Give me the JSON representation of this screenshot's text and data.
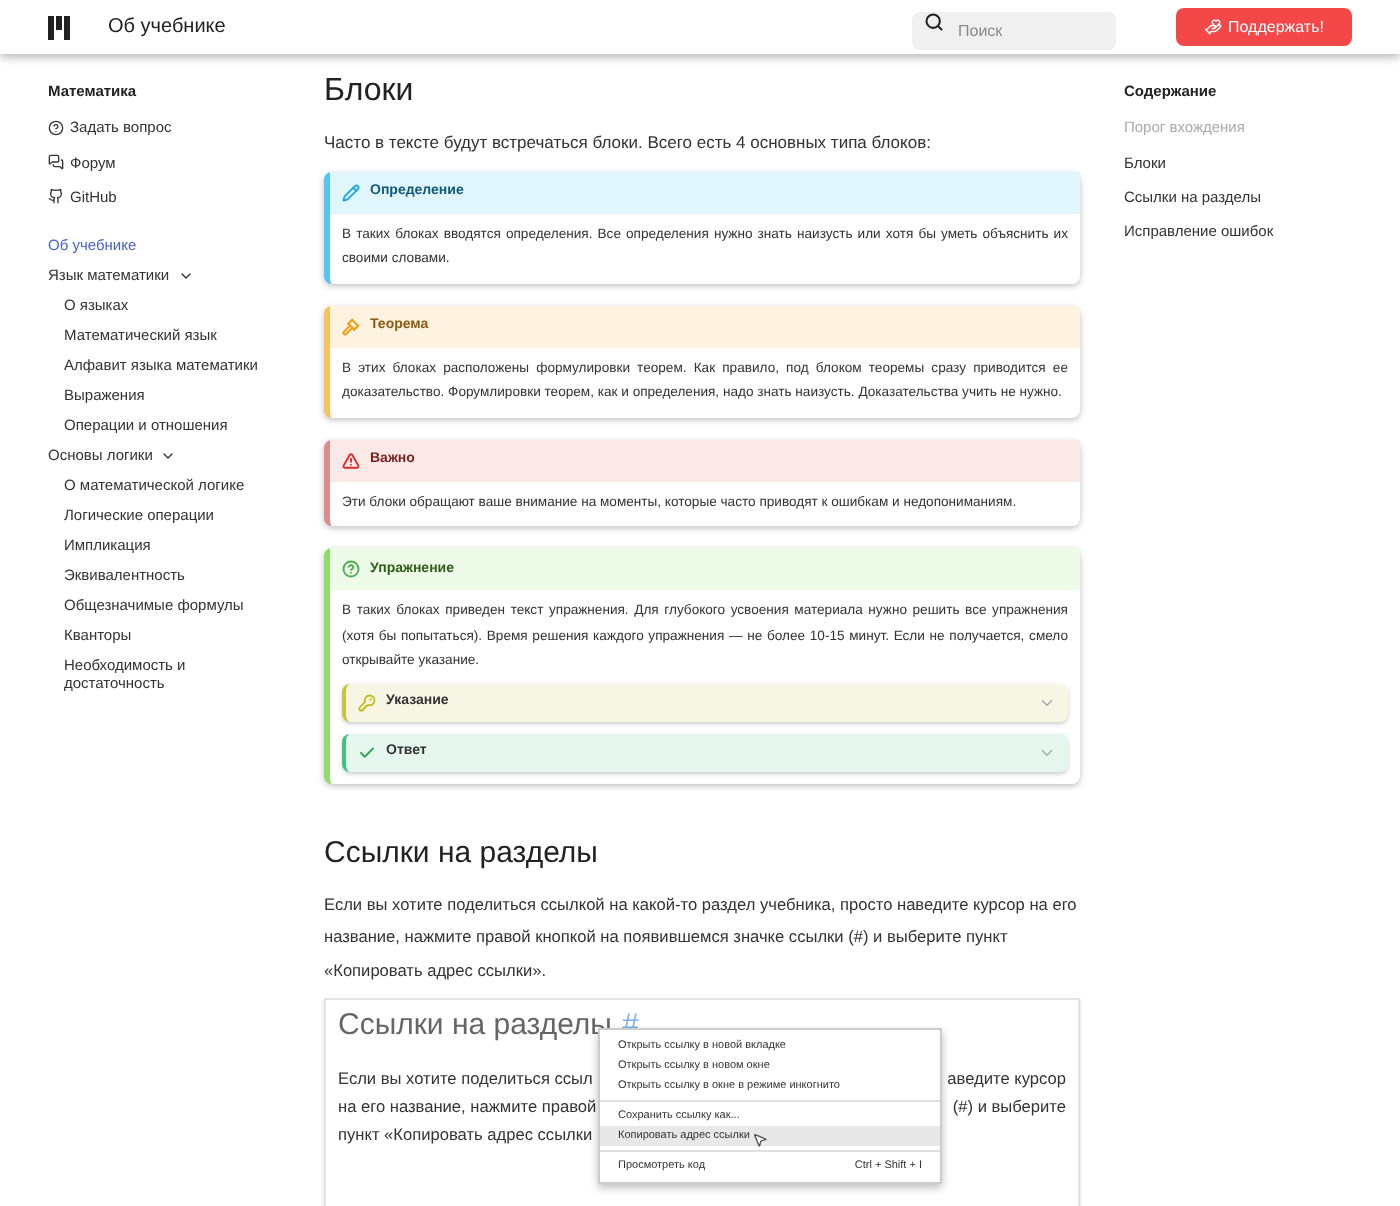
{
  "header": {
    "title": "Об учебнике",
    "search": {
      "placeholder": "Поиск"
    },
    "support_button": "Поддержать!"
  },
  "sidebar": {
    "heading": "Математика",
    "links": [
      {
        "kind": "question",
        "label": "Задать вопрос"
      },
      {
        "kind": "forum",
        "label": "Форум"
      },
      {
        "kind": "github",
        "label": "GitHub"
      }
    ],
    "items": [
      {
        "label": "Об учебнике",
        "selected": true
      },
      {
        "label": "Язык математики",
        "selected": false,
        "expanded": true,
        "children": [
          {
            "label": "О языках",
            "selected": false
          },
          {
            "label": "Математический язык",
            "selected": false
          },
          {
            "label": "Алфавит языка математики",
            "selected": false
          },
          {
            "label": "Выражения",
            "selected": false
          },
          {
            "label": "Операции и отношения",
            "selected": false
          }
        ]
      },
      {
        "label": "Основы логики",
        "selected": false,
        "expanded": true,
        "children": [
          {
            "label": "О математической логике",
            "selected": false
          },
          {
            "label": "Логические операции",
            "selected": false
          },
          {
            "label": "Импликация",
            "selected": false
          },
          {
            "label": "Эквивалентность",
            "selected": false
          },
          {
            "label": "Общезначимые формулы",
            "selected": false
          },
          {
            "label": "Кванторы",
            "selected": false
          },
          {
            "label": "Необходимость и достаточность",
            "selected": false
          }
        ]
      }
    ]
  },
  "main": {
    "title": "Блоки",
    "intro": "Часто в тексте будут встречаться блоки. Всего есть 4 основных типа блоков:",
    "blocks": [
      {
        "kind": "definition",
        "title": "Определение",
        "text": "В таких блоках вводятся определения. Все определения нужно знать наизусть или хотя бы уметь объяснить их своими словами."
      },
      {
        "kind": "theorem",
        "title": "Теорема",
        "text": "В этих блоках расположены формулировки теорем. Как правило, под блоком теоремы сразу приводится ее доказательство. Форумлировки теорем, как и определения, надо знать наизусть. Доказательства учить не нужно."
      },
      {
        "kind": "important",
        "title": "Важно",
        "text": "Эти блоки обращают ваше внимание на моменты, которые часто приводят к ошибкам и недопониманиям."
      },
      {
        "kind": "exercise",
        "title": "Упражнение",
        "text": "В таких блоках приведен текст упражнения. Для глубокого усвоения материала нужно решить все упражнения (хотя бы попытаться). Время решения каждого упражнения — не более 10-15 минут. Если не получается, смело открывайте указание.",
        "details": [
          {
            "kind": "hint",
            "title": "Указание",
            "expanded": false
          },
          {
            "kind": "answer",
            "title": "Ответ",
            "expanded": false
          }
        ]
      }
    ],
    "section_title": "Ссылки на разделы",
    "section_text": "Если вы хотите поделиться ссылкой на какой-то раздел учебника, просто наведите курсор на его название, нажмите правой кнопкой на появившемся значке ссылки (#) и выберите пункт «Копировать адрес ссылки».",
    "screenshot": {
      "title": "Ссылки на разделы",
      "anchor": "#",
      "lines": [
        {
          "left": "Если вы хотите поделиться ссыл",
          "right": "аведите курсор"
        },
        {
          "left": "на его название, нажмите правой",
          "right": "(#) и выберите"
        },
        {
          "left": "пункт «Копировать адрес ссылки"
        }
      ],
      "menu": [
        [
          {
            "label": "Открыть ссылку в новой вкладке",
            "selected": false
          },
          {
            "label": "Открыть ссылку в новом окне",
            "selected": false
          },
          {
            "label": "Открыть ссылку в окне в режиме инкогнито",
            "selected": false
          }
        ],
        [
          {
            "label": "Сохранить ссылку как...",
            "selected": false
          },
          {
            "label": "Копировать адрес ссылки",
            "selected": true
          }
        ],
        [
          {
            "label": "Просмотреть код",
            "shortcut": "Ctrl + Shift + I",
            "selected": false
          }
        ]
      ]
    }
  },
  "toc": {
    "heading": "Содержание",
    "items": [
      {
        "label": "Порог вхождения",
        "selected": false,
        "muted": true
      },
      {
        "label": "Блоки",
        "selected": false,
        "muted": false
      },
      {
        "label": "Ссылки на разделы",
        "selected": false,
        "muted": false
      },
      {
        "label": "Исправление ошибок",
        "selected": false,
        "muted": false
      }
    ]
  }
}
